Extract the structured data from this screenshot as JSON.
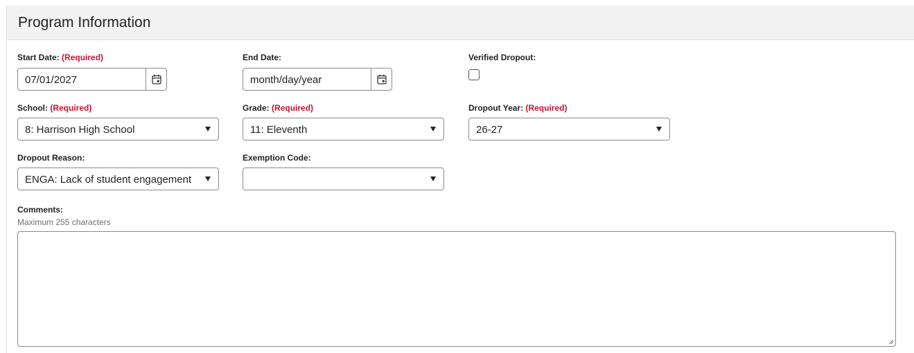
{
  "header": {
    "title": "Program Information"
  },
  "required_text": "(Required)",
  "fields": {
    "start_date": {
      "label": "Start Date:",
      "value": "07/01/2027"
    },
    "end_date": {
      "label": "End Date:",
      "placeholder": "month/day/year"
    },
    "verified_dropout": {
      "label": "Verified Dropout:",
      "checked": false
    },
    "school": {
      "label": "School:",
      "value": "8: Harrison High School"
    },
    "grade": {
      "label": "Grade:",
      "value": "11: Eleventh"
    },
    "dropout_year": {
      "label": "Dropout Year:",
      "value": "26-27"
    },
    "dropout_reason": {
      "label": "Dropout Reason:",
      "value": "ENGA: Lack of student engagement"
    },
    "exemption_code": {
      "label": "Exemption Code:",
      "value": ""
    },
    "comments": {
      "label": "Comments:",
      "hint": "Maximum 255 characters",
      "value": ""
    }
  }
}
